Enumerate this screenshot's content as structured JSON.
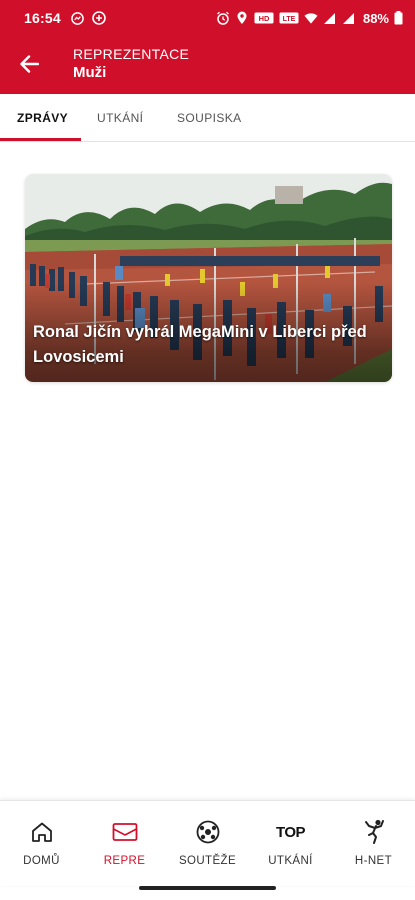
{
  "status_bar": {
    "time": "16:54",
    "battery": "88%",
    "icons_left": [
      "messenger-icon",
      "data-saver-icon"
    ],
    "icons_right": [
      "alarm-icon",
      "location-icon",
      "hd-voice-icon",
      "volte-icon",
      "wifi-icon",
      "signal-icon",
      "signal-icon-2",
      "battery-icon"
    ]
  },
  "app_bar": {
    "subtitle": "REPREZENTACE",
    "title": "Muži",
    "back_icon": "arrow-left-icon"
  },
  "tabs": [
    {
      "label": "ZPRÁVY",
      "active": true
    },
    {
      "label": "UTKÁNÍ",
      "active": false
    },
    {
      "label": "SOUPISKA",
      "active": false
    }
  ],
  "news": [
    {
      "title": "Ronal Jičín vyhrál MegaMini v Liberci před Lovosicemi"
    }
  ],
  "bottom_nav": [
    {
      "label": "DOMŮ",
      "icon": "home-icon",
      "active": false
    },
    {
      "label": "REPRE",
      "icon": "jersey-icon",
      "active": true
    },
    {
      "label": "SOUTĚŽE",
      "icon": "ball-icon",
      "active": false
    },
    {
      "label": "UTKÁNÍ",
      "icon": "top-icon",
      "icon_text": "TOP",
      "active": false
    },
    {
      "label": "H-NET",
      "icon": "player-icon",
      "active": false
    }
  ],
  "colors": {
    "brand_red": "#d0102a",
    "active_label": "#d0102a"
  }
}
